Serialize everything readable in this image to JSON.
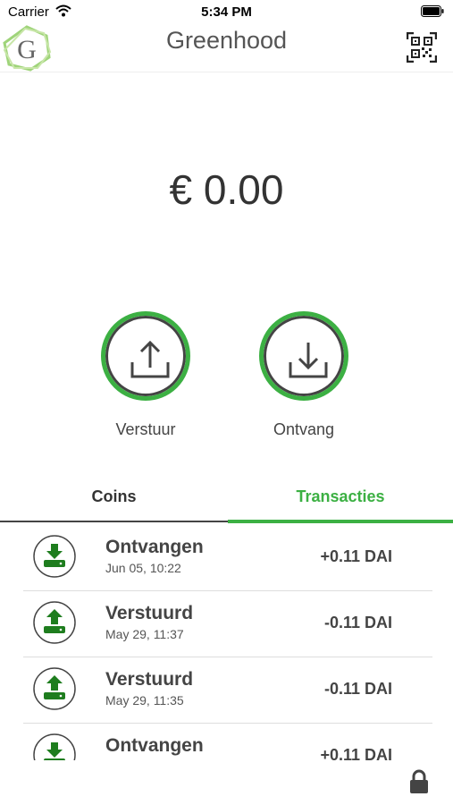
{
  "status_bar": {
    "carrier": "Carrier",
    "time": "5:34 PM"
  },
  "header": {
    "title": "Greenhood",
    "logo_letter": "G"
  },
  "balance": "€ 0.00",
  "actions": {
    "send_label": "Verstuur",
    "receive_label": "Ontvang"
  },
  "tabs": [
    {
      "label": "Coins",
      "active": false
    },
    {
      "label": "Transacties",
      "active": true
    }
  ],
  "transactions": [
    {
      "type": "Ontvangen",
      "date": "Jun 05, 10:22",
      "amount": "+0.11 DAI",
      "direction": "in"
    },
    {
      "type": "Verstuurd",
      "date": "May 29, 11:37",
      "amount": "-0.11 DAI",
      "direction": "out"
    },
    {
      "type": "Verstuurd",
      "date": "May 29, 11:35",
      "amount": "-0.11 DAI",
      "direction": "out"
    },
    {
      "type": "Ontvangen",
      "date": "",
      "amount": "+0.11 DAI",
      "direction": "in"
    }
  ],
  "colors": {
    "accent": "#3cb043",
    "icon_green": "#1e7d1e",
    "text": "#444444"
  }
}
